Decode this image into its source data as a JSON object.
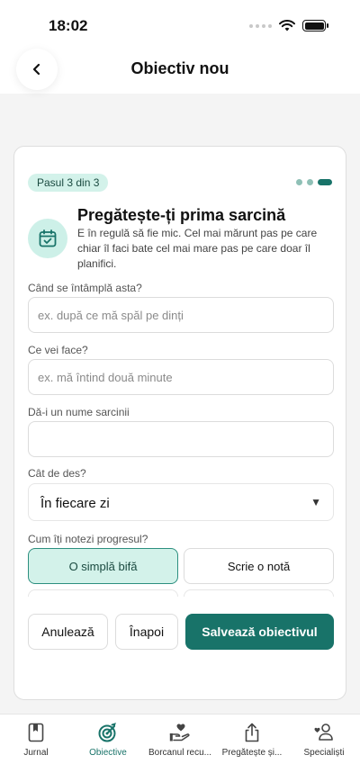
{
  "status_bar": {
    "time": "18:02"
  },
  "header": {
    "title": "Obiectiv nou"
  },
  "card": {
    "step_badge": "Pasul 3 din 3",
    "title": "Pregătește-ți prima sarcină",
    "description": "E în regulă să fie mic. Cel mai mărunt pas pe care chiar îl faci bate cel mai mare pas pe care doar îl planifici.",
    "fields": {
      "when": {
        "label": "Când se întâmplă asta?",
        "placeholder": "ex. după ce mă spăl pe dinți",
        "value": ""
      },
      "what": {
        "label": "Ce vei face?",
        "placeholder": "ex. mă întind două minute",
        "value": ""
      },
      "name": {
        "label": "Dă-i un nume sarcinii",
        "placeholder": "",
        "value": ""
      },
      "frequency": {
        "label": "Cât de des?",
        "selected": "În fiecare zi"
      },
      "progress": {
        "label": "Cum îți notezi progresul?",
        "options": [
          "O simplă bifă",
          "Scrie o notă"
        ],
        "selected": "O simplă bifă"
      }
    },
    "actions": {
      "cancel": "Anulează",
      "back": "Înapoi",
      "save": "Salvează obiectivul"
    }
  },
  "tabs": [
    {
      "label": "Jurnal",
      "icon": "journal-icon",
      "active": false
    },
    {
      "label": "Obiective",
      "icon": "target-icon",
      "active": true
    },
    {
      "label": "Borcanul recu...",
      "icon": "heart-hand-icon",
      "active": false
    },
    {
      "label": "Pregătește și...",
      "icon": "share-icon",
      "active": false
    },
    {
      "label": "Specialiști",
      "icon": "specialist-icon",
      "active": false
    }
  ],
  "colors": {
    "accent": "#187369",
    "accent_light": "#d3f2ea",
    "background": "#f4f4f4"
  }
}
